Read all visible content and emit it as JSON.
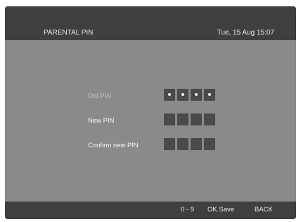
{
  "header": {
    "title": "PARENTAL PIN",
    "datetime": "Tue, 15 Aug  15:07"
  },
  "form": {
    "old_pin": {
      "label": "Old PIN",
      "digits_entered": 4,
      "length": 4
    },
    "new_pin": {
      "label": "New PIN",
      "digits_entered": 0,
      "length": 4
    },
    "confirm_pin": {
      "label": "Confirm  new PIN",
      "digits_entered": 0,
      "length": 4
    }
  },
  "footer": {
    "digits_hint": "0 - 9",
    "ok_hint": "OK Save",
    "back_hint": "BACK"
  },
  "colors": {
    "header_bg": "#3f3f3f",
    "screen_bg": "#8a8a8a",
    "box_bg": "#4a4a4a",
    "text": "#ececec"
  }
}
